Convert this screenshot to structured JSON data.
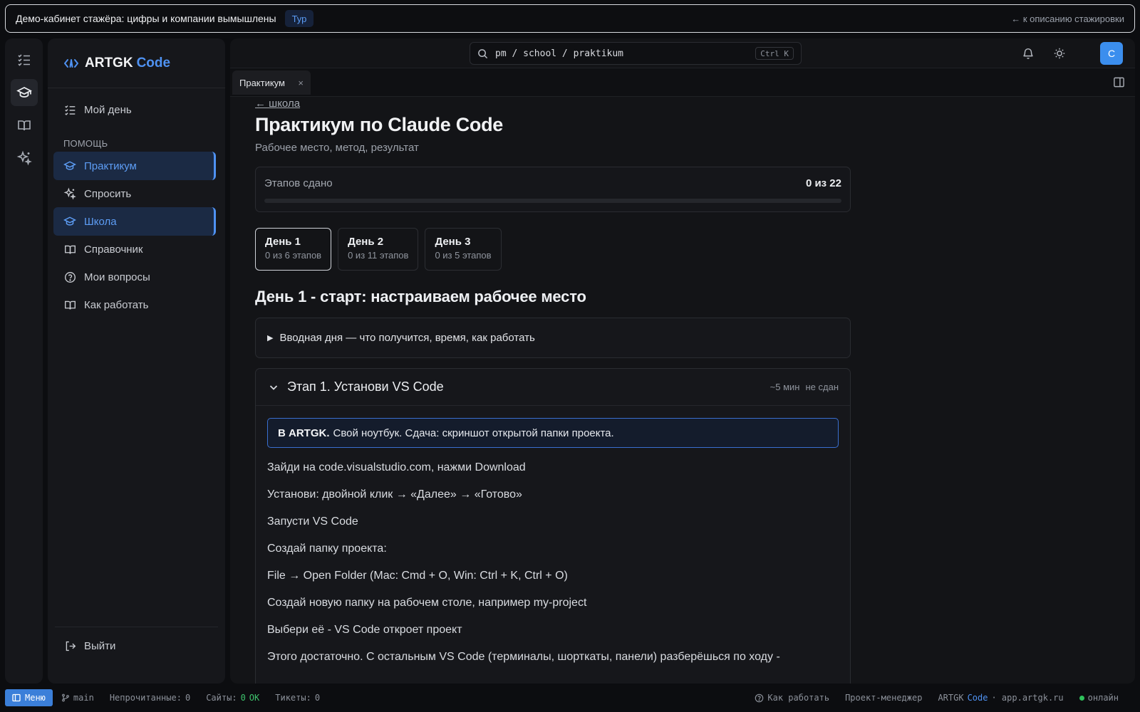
{
  "banner": {
    "text": "Демо-кабинет стажёра: цифры и компании вымышлены",
    "tour": "Тур",
    "back": "← к описанию стажировки"
  },
  "rail": {
    "items": [
      {
        "icon": "checklist-icon"
      },
      {
        "icon": "graduation-cap-icon",
        "active": true
      },
      {
        "icon": "book-icon"
      },
      {
        "icon": "sparkles-icon"
      }
    ]
  },
  "sidebar": {
    "brand": "ARTGK",
    "brand_accent": "Code",
    "my_day": "Мой день",
    "help_label": "ПОМОЩЬ",
    "items": [
      {
        "label": "Практикум",
        "icon": "graduation-cap-icon",
        "active": true
      },
      {
        "label": "Спросить",
        "icon": "sparkles-icon"
      },
      {
        "label": "Школа",
        "icon": "graduation-cap-icon",
        "active": true
      },
      {
        "label": "Справочник",
        "icon": "book-icon"
      },
      {
        "label": "Мои вопросы",
        "icon": "help-circle-icon"
      },
      {
        "label": "Как работать",
        "icon": "book-icon"
      }
    ],
    "logout": "Выйти"
  },
  "topbar": {
    "search_path": "pm / school / praktikum",
    "search_shortcut": "Ctrl K",
    "avatar_letter": "C"
  },
  "tabs": {
    "active": "Практикум",
    "close": "×"
  },
  "page": {
    "crumb": "← школа",
    "title": "Практикум по Claude Code",
    "subtitle": "Рабочее место, метод, результат",
    "progress": {
      "label": "Этапов сдано",
      "value_text": "0 из 22",
      "fraction": 0
    },
    "days": [
      {
        "name": "День 1",
        "sub": "0 из 6 этапов",
        "active": true
      },
      {
        "name": "День 2",
        "sub": "0 из 11 этапов"
      },
      {
        "name": "День 3",
        "sub": "0 из 5 этапов"
      }
    ],
    "day_heading": "День 1 - старт: настраиваем рабочее место",
    "intro": "Вводная дня — что получится, время, как работать",
    "stage": {
      "title": "Этап 1. Установи VS Code",
      "time": "~5 мин",
      "status": "не сдан",
      "note_bold": "В ARTGK.",
      "note_text": "Свой ноутбук. Сдача: скриншот открытой папки проекта.",
      "steps": [
        "Зайди на code.visualstudio.com, нажми Download",
        "Установи: двойной клик → «Далее» → «Готово»",
        "Запусти VS Code",
        "Создай папку проекта:",
        "File → Open Folder (Mac: Cmd + O, Win: Ctrl + K, Ctrl + O)",
        "Создай новую папку на рабочем столе, например my-project",
        "Выбери её - VS Code откроет проект",
        "Этого достаточно. С остальным VS Code (терминалы, шорткаты, панели) разберёшься по ходу -"
      ]
    }
  },
  "statusbar": {
    "menu": "Меню",
    "branch": "main",
    "unread_label": "Непрочитанные:",
    "unread_value": "0",
    "sites_label": "Сайты:",
    "sites_count": "0",
    "sites_status": "OK",
    "tickets_label": "Тикеты:",
    "tickets_value": "0",
    "how_to": "Как работать",
    "role": "Проект-менеджер",
    "brand": "ARTGK",
    "brand_accent": "Code",
    "domain": "· app.artgk.ru",
    "online": "онлайн"
  },
  "colors": {
    "accent": "#4f92f2",
    "ok": "#3ec46d",
    "background": "#0c0d10"
  }
}
